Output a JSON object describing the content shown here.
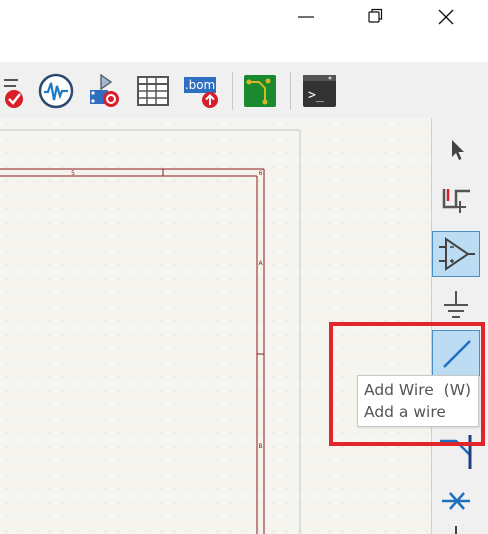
{
  "window": {
    "controls": [
      {
        "name": "minimize",
        "icon": "minimize-icon"
      },
      {
        "name": "maximize",
        "icon": "restore-icon"
      },
      {
        "name": "close",
        "icon": "close-icon"
      }
    ]
  },
  "toolbar": {
    "tools": [
      {
        "name": "electrical-rules-check",
        "icon": "erc-check-icon"
      },
      {
        "name": "simulator",
        "icon": "oscilloscope-icon"
      },
      {
        "name": "assign-footprints",
        "icon": "footprint-assign-icon"
      },
      {
        "name": "symbol-fields-table",
        "icon": "table-icon"
      },
      {
        "name": "generate-bom",
        "icon": "bom-icon",
        "label": ".bom"
      },
      {
        "name": "open-pcb-editor",
        "icon": "pcb-icon"
      },
      {
        "name": "scripting-console",
        "icon": "console-icon",
        "label": ">_"
      }
    ]
  },
  "canvas": {
    "sheet_column_label": "5",
    "sheet_corner_label": "6",
    "row_labels": [
      "A",
      "B"
    ],
    "colors": {
      "background": "#f5f4ef",
      "sheet_border": "#8b1a1a",
      "grid_dot": "#c4c4c4"
    }
  },
  "right_toolbar": {
    "tools": [
      {
        "name": "select",
        "icon": "cursor-icon",
        "active": false
      },
      {
        "name": "highlight-net",
        "icon": "net-highlight-icon",
        "active": false
      },
      {
        "name": "add-symbol",
        "icon": "opamp-symbol-icon",
        "active": true
      },
      {
        "name": "add-power",
        "icon": "ground-icon",
        "active": false
      },
      {
        "name": "add-wire",
        "icon": "wire-icon",
        "active": true
      },
      {
        "name": "add-bus",
        "icon": "bus-entry-icon",
        "active": false
      },
      {
        "name": "no-connect",
        "icon": "no-connect-icon",
        "active": false
      }
    ]
  },
  "tooltip": {
    "title": "Add Wire  (W)",
    "description": "Add a wire"
  },
  "highlight": {
    "color": "#e0262a"
  }
}
